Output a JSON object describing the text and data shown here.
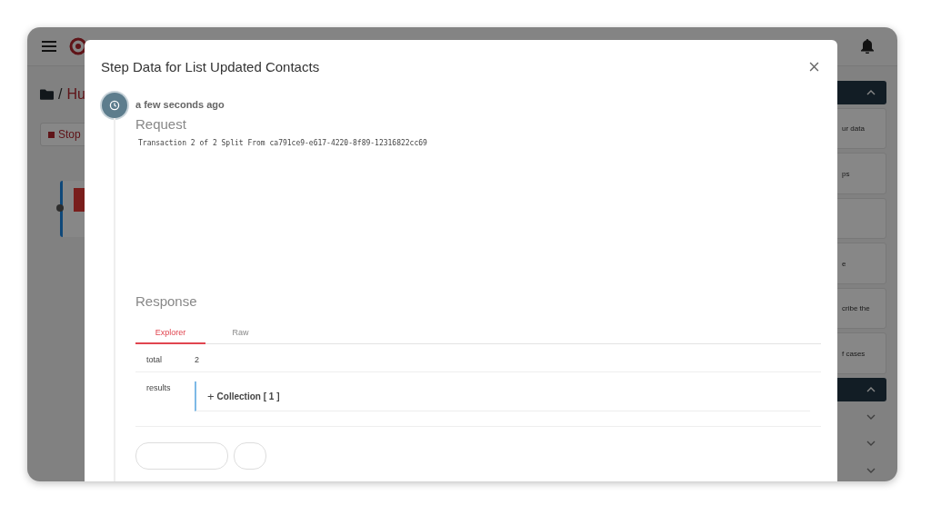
{
  "background": {
    "breadcrumb": {
      "separator": "/",
      "current": "Hu"
    },
    "stop_button": "Stop",
    "panel_sections": [
      {
        "expanded": true,
        "cards": [
          {
            "kind": "text",
            "text": "ur data"
          },
          {
            "kind": "text",
            "text": "ps"
          },
          {
            "kind": "blank"
          },
          {
            "kind": "text",
            "text": "e"
          },
          {
            "kind": "text",
            "text": "cribe the"
          },
          {
            "kind": "text",
            "text": "f cases"
          }
        ]
      },
      {
        "expanded": true
      },
      {
        "expanded": false
      },
      {
        "expanded": false
      },
      {
        "expanded": false
      }
    ]
  },
  "modal": {
    "title": "Step Data for List Updated Contacts",
    "time": "a few seconds ago",
    "request": {
      "heading": "Request",
      "body": "Transaction 2 of 2 Split From ca791ce9-e617-4220-8f89-12316822cc69"
    },
    "response": {
      "heading": "Response",
      "tabs": [
        {
          "label": "Explorer",
          "selected": true
        },
        {
          "label": "Raw",
          "selected": false
        }
      ],
      "rows": [
        {
          "key": "total",
          "kind": "value",
          "value": "2"
        },
        {
          "key": "results",
          "kind": "collection",
          "value": "Collection [ 1 ]",
          "toggle": "+"
        }
      ]
    }
  }
}
